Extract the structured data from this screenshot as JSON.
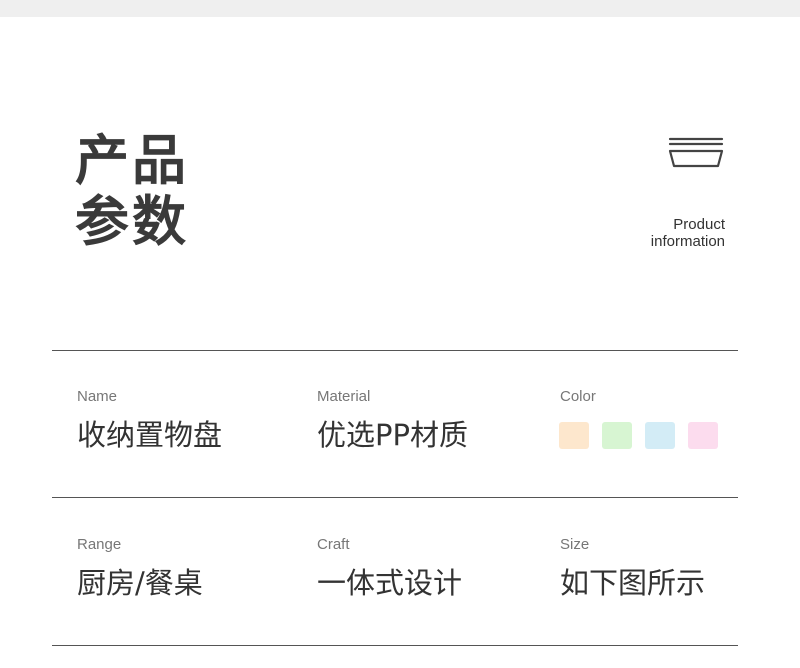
{
  "header": {
    "title_line1": "产品",
    "title_line2": "参数",
    "subtitle_line1": "Product",
    "subtitle_line2": "information",
    "icon": "tray-icon"
  },
  "specs": [
    {
      "label": "Name",
      "value": "收纳置物盘"
    },
    {
      "label": "Material",
      "value": "优选PP材质"
    },
    {
      "label": "Color",
      "swatches": [
        "#fde7cd",
        "#d7f5d2",
        "#d3ecf6",
        "#fcdcee"
      ]
    },
    {
      "label": "Range",
      "value": "厨房/餐桌"
    },
    {
      "label": "Craft",
      "value": "一体式设计"
    },
    {
      "label": "Size",
      "value": "如下图所示"
    }
  ]
}
